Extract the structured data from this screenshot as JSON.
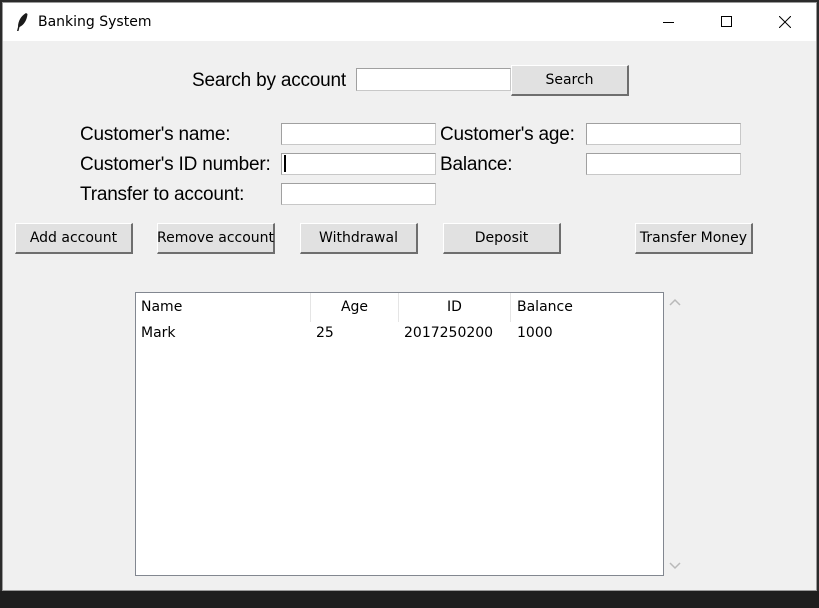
{
  "window": {
    "title": "Banking System"
  },
  "search": {
    "label": "Search by account",
    "value": "",
    "button_label": "Search"
  },
  "form": {
    "name_label": "Customer's name:",
    "age_label": "Customer's age:",
    "id_label": "Customer's ID number:",
    "balance_label": "Balance:",
    "transfer_label": "Transfer to account:",
    "name_value": "",
    "age_value": "",
    "id_value": "",
    "balance_value": "",
    "transfer_value": ""
  },
  "actions": {
    "add": "Add account",
    "remove": "Remove account",
    "withdraw": "Withdrawal",
    "deposit": "Deposit",
    "transfer": "Transfer Money"
  },
  "table": {
    "columns": [
      "Name",
      "Age",
      "ID",
      "Balance"
    ],
    "rows": [
      [
        "Mark",
        "25",
        "2017250200",
        "1000"
      ]
    ]
  },
  "icons": {
    "app": "feather-icon",
    "minimize": "minimize-icon",
    "maximize": "maximize-icon",
    "close": "close-icon"
  }
}
